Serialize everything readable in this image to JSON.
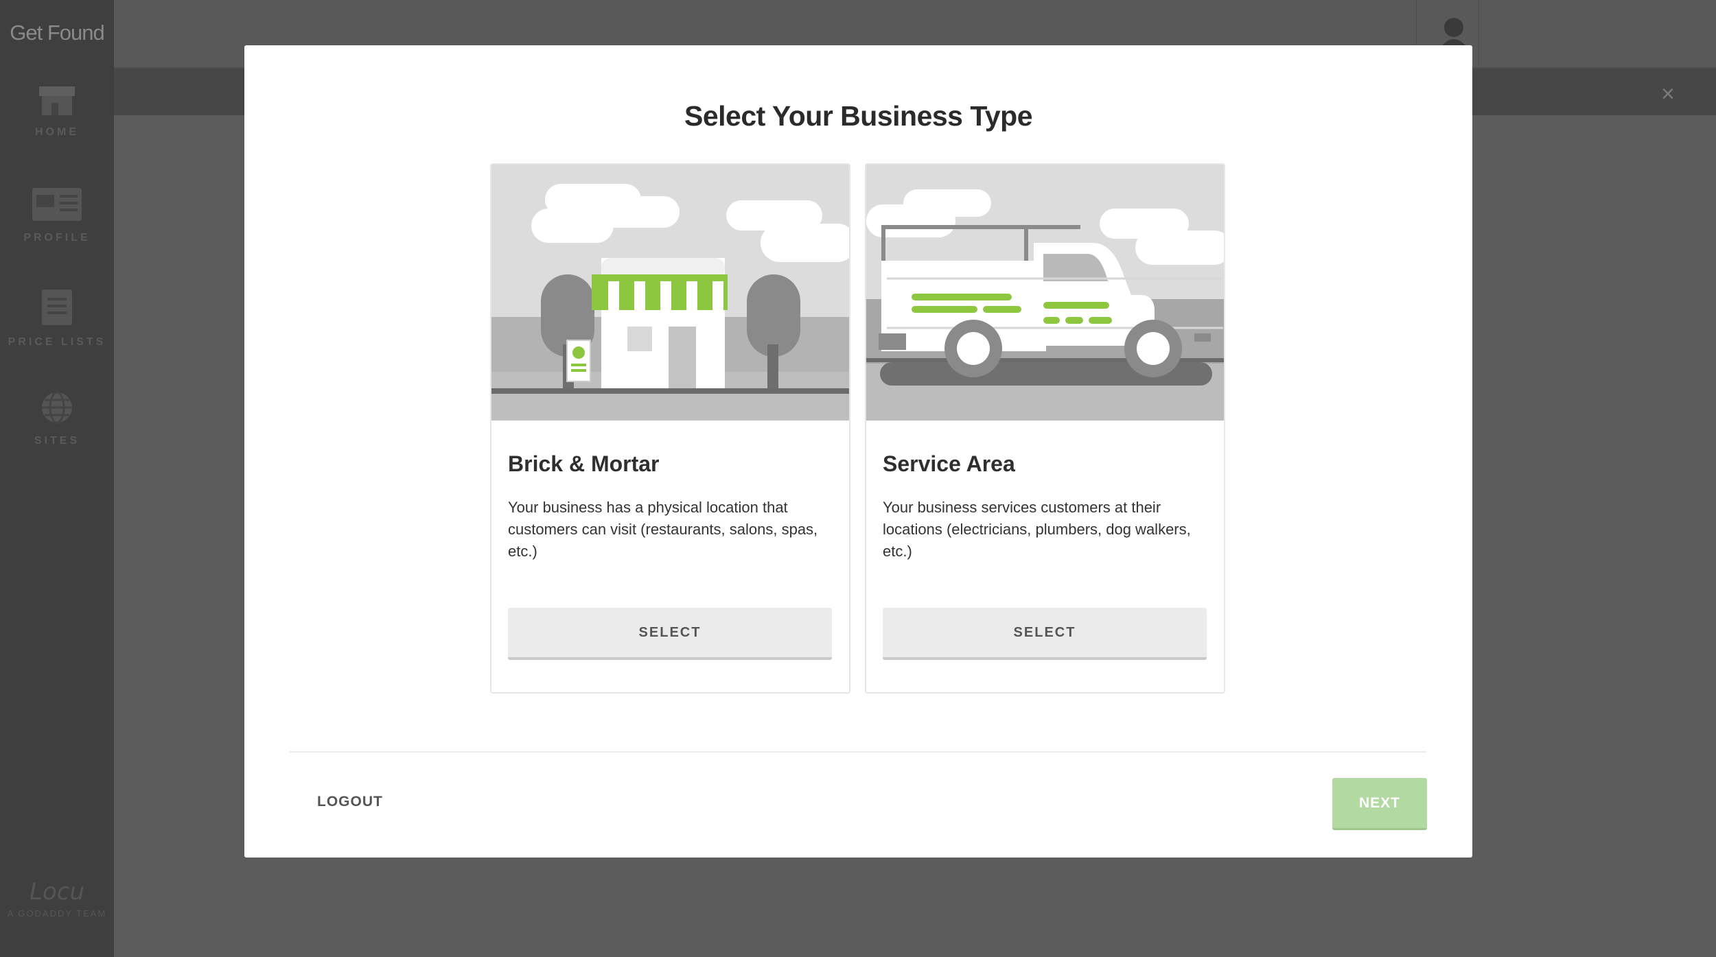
{
  "app": {
    "brand": "Get Found"
  },
  "sidebar": {
    "items": [
      {
        "label": "HOME",
        "icon": "storefront-icon"
      },
      {
        "label": "PROFILE",
        "icon": "profile-card-icon"
      },
      {
        "label": "PRICE LISTS",
        "icon": "document-list-icon"
      },
      {
        "label": "SITES",
        "icon": "globe-icon"
      }
    ],
    "footer": {
      "logo": "Locu",
      "tagline": "A GODADDY TEAM"
    }
  },
  "topbar": {
    "user_icon": "user-avatar-icon",
    "close_icon": "close-icon",
    "close_glyph": "×"
  },
  "modal": {
    "title": "Select Your Business Type",
    "cards": [
      {
        "title": "Brick & Mortar",
        "description": "Your business has a physical location that customers can visit (restaurants, salons, spas, etc.)",
        "button": "SELECT",
        "illustration": "storefront-illustration"
      },
      {
        "title": "Service Area",
        "description": "Your business services customers at their locations (electricians, plumbers, dog walkers, etc.)",
        "button": "SELECT",
        "illustration": "service-truck-illustration"
      }
    ],
    "footer": {
      "logout": "LOGOUT",
      "next": "NEXT"
    }
  },
  "colors": {
    "accent_green": "#8dc63f",
    "next_disabled": "#b3d9a2",
    "overlay": "#5c5c5c",
    "sidebar": "#3f3f3f"
  }
}
